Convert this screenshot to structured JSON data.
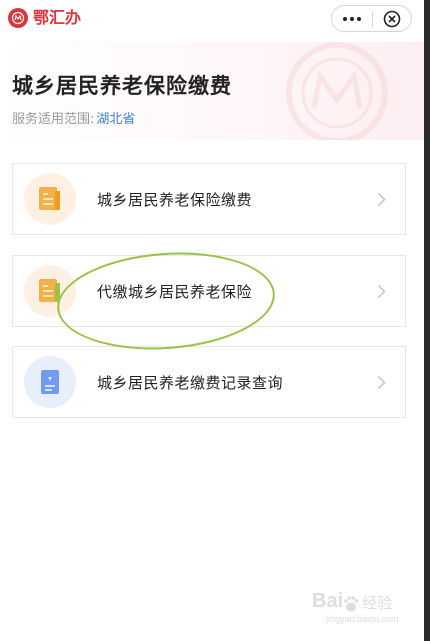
{
  "topbar": {
    "app_name": "鄂汇办"
  },
  "header": {
    "title": "城乡居民养老保险缴费",
    "scope_label": "服务适用范围:",
    "scope_region": "湖北省"
  },
  "services": [
    {
      "label": "城乡居民养老保险缴费",
      "icon": "document-icon"
    },
    {
      "label": "代缴城乡居民养老保险",
      "icon": "document-icon"
    },
    {
      "label": "城乡居民养老缴费记录查询",
      "icon": "record-query-icon"
    }
  ],
  "watermark": {
    "brand": "Bai",
    "sub": "经验",
    "url": "jingyan.baidu.com"
  },
  "colors": {
    "brand_red": "#d9363e",
    "link_blue": "#3f7fdc",
    "highlight_green": "#9bc247",
    "icon_orange": "#f6b04a"
  }
}
